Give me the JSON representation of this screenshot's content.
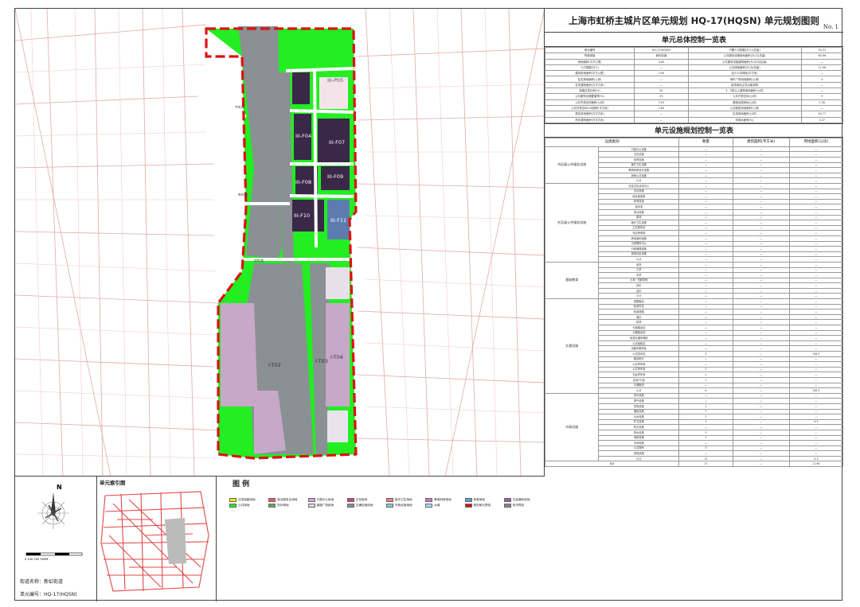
{
  "sheet": {
    "title": "上海市虹桥主城片区单元规划   HQ-17(HQSN) 单元规划图则",
    "sheet_no": "No. 1"
  },
  "map": {
    "parcels": [
      {
        "label": "III-P05"
      },
      {
        "label": "III-F04"
      },
      {
        "label": "III-F07"
      },
      {
        "label": "III-T01"
      },
      {
        "label": "III-F09"
      },
      {
        "label": "III-F08"
      },
      {
        "label": "III-F10"
      },
      {
        "label": "III-F11"
      },
      {
        "label": "I-T02"
      },
      {
        "label": "I-T03"
      },
      {
        "label": "I-T04"
      }
    ],
    "road_labels": [
      "中虹路",
      "新虹路",
      "申虹路"
    ]
  },
  "colors": {
    "green": "#22ee22",
    "gray": "#8a9094",
    "purple": "#3a2848",
    "pink": "#c8a8c8",
    "blue": "#5c7cb0",
    "boundary": "#dd1111",
    "road": "#bb4444"
  },
  "control_table": {
    "title": "单元总体控制一览表",
    "rows": [
      [
        "单元编号",
        "HQ-17(HQSN)",
        "户籍人口规模(万人)(总量)",
        "33.31"
      ],
      [
        "所属街镇",
        "新虹街道",
        "公共服务设施用地面积(万㎡)(总量)",
        "63.96"
      ],
      [
        "用地面积(平方公里)",
        "3.65",
        "公共服务设施建筑面积(万㎡)(社区级)",
        "—"
      ],
      [
        "人口规模(万人)",
        "—",
        "公共绿地面积(万㎡)(总量)",
        "11.96"
      ],
      [
        "建设用地面积(平方公里)",
        "2.90",
        "至少人均绿地(平方米)",
        "—"
      ],
      [
        "住宅用地面积(公顷)",
        "—",
        "城市广场用地面积(公顷)",
        "4"
      ],
      [
        "住宅建筑面积(万平方米)",
        "—",
        "各类用地主导功能说明",
        "—"
      ],
      [
        "新建住宅比例(%)",
        "30",
        "3、5层以上建筑用地面积(公顷)",
        "—"
      ],
      [
        "公共服务设施配套率(%)",
        "20",
        "公共开放空间(公顷)",
        "9"
      ],
      [
        "公共开放空间面积(公顷)",
        "3.53",
        "基础设施用地(公顷)",
        "1.30"
      ],
      [
        "公共开放空间人均面积(平方米)",
        "2.60",
        "公交枢纽用地面积(公顷)",
        "—"
      ],
      [
        "居住用地面积(万平方米)",
        "—",
        "生态用地面积(公顷)",
        "44.77"
      ],
      [
        "商业建筑面积(万平方米)",
        "—",
        "河湖水面率(%)",
        "2.37"
      ]
    ]
  },
  "facility_table": {
    "title": "单元设施规划控制一览表",
    "headers": [
      "设施类别",
      "",
      "数量",
      "建筑面积(平方米)",
      "用地面积(公顷)"
    ],
    "groups": [
      {
        "name": "市区级公共服务设施",
        "rows": [
          [
            "行政办公设施",
            "—",
            "—",
            "—"
          ],
          [
            "文化设施",
            "—",
            "—",
            "—"
          ],
          [
            "体育设施",
            "—",
            "—",
            "—"
          ],
          [
            "医疗卫生设施",
            "—",
            "—",
            "—"
          ],
          [
            "教育科研设计设施",
            "—",
            "—",
            "—"
          ],
          [
            "其他公共设施",
            "—",
            "—",
            "—"
          ],
          [
            "小计",
            "—",
            "—",
            "—"
          ]
        ]
      },
      {
        "name": "社区级公共服务设施",
        "rows": [
          [
            "社区文化活动中心",
            "—",
            "—",
            "—"
          ],
          [
            "文化设施",
            "—",
            "—",
            "—"
          ],
          [
            "综合健身馆",
            "—",
            "—",
            "—"
          ],
          [
            "体育设施",
            "—",
            "—",
            "—"
          ],
          [
            "游泳池",
            "—",
            "—",
            "—"
          ],
          [
            "商业设施",
            "—",
            "—",
            "—"
          ],
          [
            "菜场",
            "—",
            "—",
            "—"
          ],
          [
            "医疗卫生设施",
            "—",
            "—",
            "—"
          ],
          [
            "卫生服务站",
            "—",
            "—",
            "—"
          ],
          [
            "社区养老院",
            "—",
            "—",
            "—"
          ],
          [
            "养老福利设施",
            "—",
            "—",
            "—"
          ],
          [
            "日间照料中心",
            "—",
            "—",
            "—"
          ],
          [
            "行政管理设施",
            "—",
            "—",
            "—"
          ],
          [
            "其他社区设施",
            "—",
            "—",
            "—"
          ],
          [
            "小计",
            "—",
            "—",
            "—"
          ]
        ]
      },
      {
        "name": "基础教育",
        "rows": [
          [
            "幼托",
            "—",
            "—",
            "—"
          ],
          [
            "小学",
            "—",
            "—",
            "—"
          ],
          [
            "中学",
            "—",
            "—",
            "—"
          ],
          [
            "九年一贯制学校",
            "—",
            "—",
            "—"
          ],
          [
            "初中",
            "—",
            "—",
            "—"
          ],
          [
            "高中",
            "—",
            "—",
            "—"
          ],
          [
            "小计",
            "—",
            "—",
            "—"
          ]
        ]
      },
      {
        "name": "交通设施",
        "rows": [
          [
            "铁路客站",
            "—",
            "—",
            "—"
          ],
          [
            "轨道车站",
            "—",
            "—",
            "—"
          ],
          [
            "轨道线路",
            "—",
            "—",
            "—"
          ],
          [
            "港口",
            "—",
            "—",
            "—"
          ],
          [
            "机场",
            "—",
            "—",
            "—"
          ],
          [
            "长途客运站",
            "—",
            "—",
            "—"
          ],
          [
            "公路客运站",
            "—",
            "—",
            "—"
          ],
          [
            "轨道交通车辆段",
            "—",
            "—",
            "—"
          ],
          [
            "公交枢纽站",
            "—",
            "—",
            "—"
          ],
          [
            "出租车服务站",
            "—",
            "—",
            "—"
          ],
          [
            "公交首末站",
            "3",
            "—",
            "136.5"
          ],
          [
            "客运码头",
            "—",
            "—",
            "—"
          ],
          [
            "公交停车场",
            "—",
            "—",
            "—"
          ],
          [
            "公共停车场",
            "1",
            "—",
            "—"
          ],
          [
            "社会停车场",
            "1",
            "—",
            "—"
          ],
          [
            "加油(气)站",
            "1",
            "—",
            "—"
          ],
          [
            "交通枢纽",
            "—",
            "—",
            "—"
          ],
          [
            "小计",
            "6",
            "—",
            "136.5"
          ]
        ]
      },
      {
        "name": "市政设施",
        "rows": [
          [
            "供水设施",
            "—",
            "—",
            "—"
          ],
          [
            "燃气设施",
            "—",
            "—",
            "—"
          ],
          [
            "供电设施",
            "1",
            "—",
            "—"
          ],
          [
            "通信设施",
            "1",
            "—",
            "—"
          ],
          [
            "污水设施",
            "1",
            "—",
            "—"
          ],
          [
            "环卫设施",
            "2",
            "—",
            "4.3"
          ],
          [
            "防灾设施",
            "—",
            "—",
            "—"
          ],
          [
            "排水设施",
            "3",
            "—",
            "—"
          ],
          [
            "消防设施",
            "1",
            "—",
            "—"
          ],
          [
            "水利设施",
            "—",
            "—",
            "—"
          ],
          [
            "公共厕所",
            "3",
            "—",
            "—"
          ],
          [
            "其他设施",
            "—",
            "—",
            "—"
          ],
          [
            "小计",
            "12",
            "—",
            "4.3"
          ]
        ]
      }
    ],
    "total": [
      "总计",
      "17",
      "—",
      "11.96"
    ]
  },
  "bottom": {
    "north_label": "N",
    "scale_label": "0   100   200    500M",
    "index_title": "单元索引图",
    "legend_title": "图  例",
    "street_label": "街道名称：新虹街道",
    "unit_label": "单元编号：HQ-17(HQSN)",
    "legend_items": [
      "住宅组团用地",
      "商业服务业用地",
      "行政办公用地",
      "文化用地",
      "医疗卫生用地",
      "教育科研用地",
      "体育用地",
      "社会福利用地",
      "公共绿地",
      "防护绿地",
      "道路广场用地",
      "交通设施用地",
      "市政设施用地",
      "水域",
      "规划单元界线",
      "街坊界线"
    ]
  }
}
